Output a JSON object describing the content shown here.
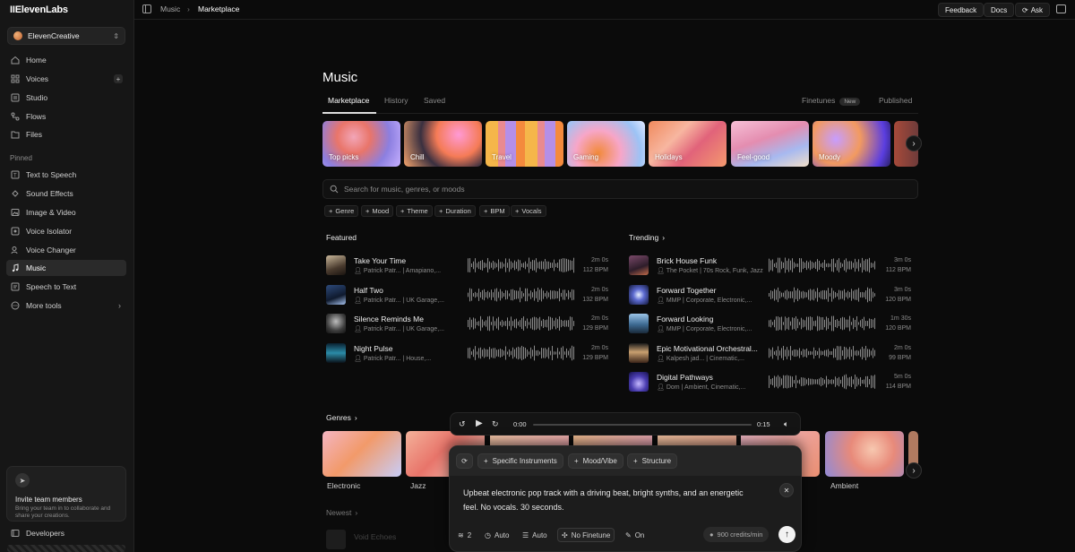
{
  "app": {
    "logo": "IIElevenLabs"
  },
  "workspace": {
    "name": "ElevenCreative"
  },
  "nav": [
    {
      "label": "Home",
      "icon": "home-icon"
    },
    {
      "label": "Voices",
      "icon": "voices-icon"
    },
    {
      "label": "Studio",
      "icon": "studio-icon"
    },
    {
      "label": "Flows",
      "icon": "flows-icon"
    },
    {
      "label": "Files",
      "icon": "files-icon"
    }
  ],
  "pinned_label": "Pinned",
  "pinned": [
    {
      "label": "Text to Speech"
    },
    {
      "label": "Sound Effects"
    },
    {
      "label": "Image & Video"
    },
    {
      "label": "Voice Isolator"
    },
    {
      "label": "Voice Changer"
    },
    {
      "label": "Music"
    },
    {
      "label": "Speech to Text"
    },
    {
      "label": "More tools"
    }
  ],
  "invite": {
    "title": "Invite team members",
    "subtitle": "Bring your team in to collaborate and share your creations."
  },
  "developers": "Developers",
  "breadcrumb": {
    "parent": "Music",
    "separator": "›",
    "current": "Marketplace"
  },
  "topbar": {
    "feedback": "Feedback",
    "docs": "Docs",
    "ask": "Ask"
  },
  "page": {
    "title": "Music"
  },
  "tabs": {
    "marketplace": "Marketplace",
    "history": "History",
    "saved": "Saved",
    "finetunes": "Finetunes",
    "new_badge": "New",
    "published": "Published"
  },
  "moods": [
    "Top picks",
    "Chill",
    "Travel",
    "Gaming",
    "Holidays",
    "Feel-good",
    "Moody"
  ],
  "search": {
    "placeholder": "Search for music, genres, or moods"
  },
  "filters": [
    "Genre",
    "Mood",
    "Theme",
    "Duration",
    "BPM",
    "Vocals"
  ],
  "featured": {
    "title": "Featured",
    "tracks": [
      {
        "title": "Take Your Time",
        "artist": "Patrick Patr...",
        "tags": "Amapiano,...",
        "duration": "2m 0s",
        "bpm": "112 BPM"
      },
      {
        "title": "Half Two",
        "artist": "Patrick Patr...",
        "tags": "UK Garage,...",
        "duration": "2m 0s",
        "bpm": "132 BPM"
      },
      {
        "title": "Silence Reminds Me",
        "artist": "Patrick Patr...",
        "tags": "UK Garage,...",
        "duration": "2m 0s",
        "bpm": "129 BPM"
      },
      {
        "title": "Night Pulse",
        "artist": "Patrick Patr...",
        "tags": "House,...",
        "duration": "2m 0s",
        "bpm": "129 BPM"
      }
    ]
  },
  "trending": {
    "title": "Trending",
    "tracks": [
      {
        "title": "Brick House Funk",
        "artist": "The Pocket",
        "tags": "70s Rock, Funk, Jazz",
        "duration": "3m 0s",
        "bpm": "112 BPM"
      },
      {
        "title": "Forward Together",
        "artist": "MMP",
        "tags": "Corporate, Electronic,...",
        "duration": "3m 0s",
        "bpm": "120 BPM"
      },
      {
        "title": "Forward Looking",
        "artist": "MMP",
        "tags": "Corporate, Electronic,...",
        "duration": "1m 30s",
        "bpm": "120 BPM"
      },
      {
        "title": "Epic Motivational Orchestral...",
        "artist": "Kalpesh jad...",
        "tags": "Cinematic,...",
        "duration": "2m 0s",
        "bpm": "99 BPM"
      },
      {
        "title": "Digital Pathways",
        "artist": "Dom",
        "tags": "Ambient, Cinematic,...",
        "duration": "5m 0s",
        "bpm": "114 BPM"
      }
    ]
  },
  "genres": {
    "title": "Genres",
    "items": [
      "Electronic",
      "Jazz",
      "Ambient"
    ]
  },
  "newest": {
    "title": "Newest",
    "first": "Void Echoes"
  },
  "player": {
    "current": "0:00",
    "total": "0:15",
    "progress": 0
  },
  "composer": {
    "chips": [
      "Specific Instruments",
      "Mood/Vibe",
      "Structure"
    ],
    "prompt": "Upbeat electronic pop track with a driving beat, bright synths, and an energetic feel. No vocals. 30 seconds.",
    "options": {
      "layers": "2",
      "duration": "Auto",
      "sections": "Auto",
      "finetune": "No Finetune",
      "mode": "On"
    },
    "credits": "900 credits/min"
  },
  "colors": {
    "background": "#0b0b0b",
    "sidebar": "#161616",
    "accent": "#ffffff"
  }
}
